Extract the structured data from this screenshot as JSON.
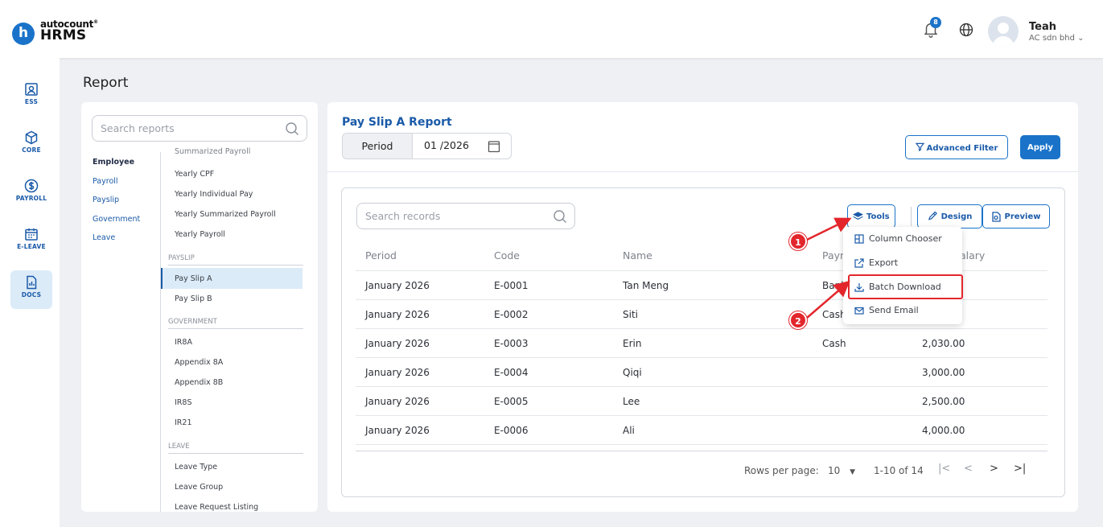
{
  "app": {
    "logo_letter": "h",
    "logo_top": "autocount",
    "logo_bottom": "HRMS",
    "notification_count": "8",
    "user_name": "Teah",
    "company": "AC sdn bhd"
  },
  "rail": [
    {
      "label": "ESS",
      "icon": "ess-icon"
    },
    {
      "label": "CORE",
      "icon": "cube-icon"
    },
    {
      "label": "PAYROLL",
      "icon": "dollar-icon"
    },
    {
      "label": "E-LEAVE",
      "icon": "calendar-icon"
    },
    {
      "label": "DOCS",
      "icon": "document-chart-icon"
    }
  ],
  "page_title": "Report",
  "report_nav": {
    "search_placeholder": "Search reports",
    "categories": [
      "Employee",
      "Payroll",
      "Payslip",
      "Government",
      "Leave"
    ],
    "items_top": [
      "Summarized Payroll",
      "Yearly CPF",
      "Yearly Individual Pay",
      "Yearly Summarized Payroll",
      "Yearly Payroll"
    ],
    "section_payslip": "PAYSLIP",
    "items_payslip": [
      "Pay Slip A",
      "Pay Slip B"
    ],
    "section_government": "GOVERNMENT",
    "items_government": [
      "IR8A",
      "Appendix 8A",
      "Appendix 8B",
      "IR8S",
      "IR21"
    ],
    "section_leave": "LEAVE",
    "items_leave": [
      "Leave Type",
      "Leave Group",
      "Leave Request Listing"
    ]
  },
  "report": {
    "title": "Pay Slip A Report",
    "period_label": "Period",
    "period_value": "01 /2026",
    "advanced_filter": "Advanced Filter",
    "apply": "Apply"
  },
  "toolbar": {
    "search_placeholder": "Search records",
    "tools": "Tools",
    "design": "Design",
    "preview": "Preview"
  },
  "tools_menu": [
    "Column Chooser",
    "Export",
    "Batch Download",
    "Send Email"
  ],
  "table": {
    "headers": [
      "Period",
      "Code",
      "Name",
      "Paym",
      "alary"
    ],
    "rows": [
      [
        "January 2026",
        "E-0001",
        "Tan Meng",
        "Bank",
        ""
      ],
      [
        "January 2026",
        "E-0002",
        "Siti",
        "Cash",
        ""
      ],
      [
        "January 2026",
        "E-0003",
        "Erin",
        "Cash",
        "2,030.00"
      ],
      [
        "January 2026",
        "E-0004",
        "Qiqi",
        "",
        "3,000.00"
      ],
      [
        "January 2026",
        "E-0005",
        "Lee",
        "",
        "2,500.00"
      ],
      [
        "January 2026",
        "E-0006",
        "Ali",
        "",
        "4,000.00"
      ]
    ]
  },
  "pagination": {
    "rows_per_page_label": "Rows per page:",
    "rows_per_page": "10",
    "range": "1-10 of 14"
  },
  "annotations": {
    "step1": "1",
    "step2": "2",
    "color": "#e3262c"
  },
  "colors": {
    "primary": "#1a73c9",
    "text_accent": "#1a5aa8"
  }
}
